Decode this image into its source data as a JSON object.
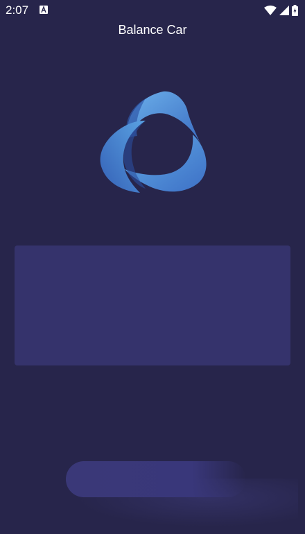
{
  "status_bar": {
    "time": "2:07",
    "notification_icon": "app-notification-icon",
    "wifi_icon": "wifi-icon",
    "signal_icon": "cell-signal-icon",
    "battery_icon": "battery-charging-icon"
  },
  "header": {
    "title": "Balance Car"
  },
  "logo": {
    "icon": "tri-swirl-logo-icon",
    "colors": {
      "light": "#5aa0e0",
      "dark": "#3462b8"
    }
  },
  "panel": {
    "color": "#35336c"
  },
  "bottom_button": {
    "label": ""
  },
  "colors": {
    "background": "#27254b"
  }
}
